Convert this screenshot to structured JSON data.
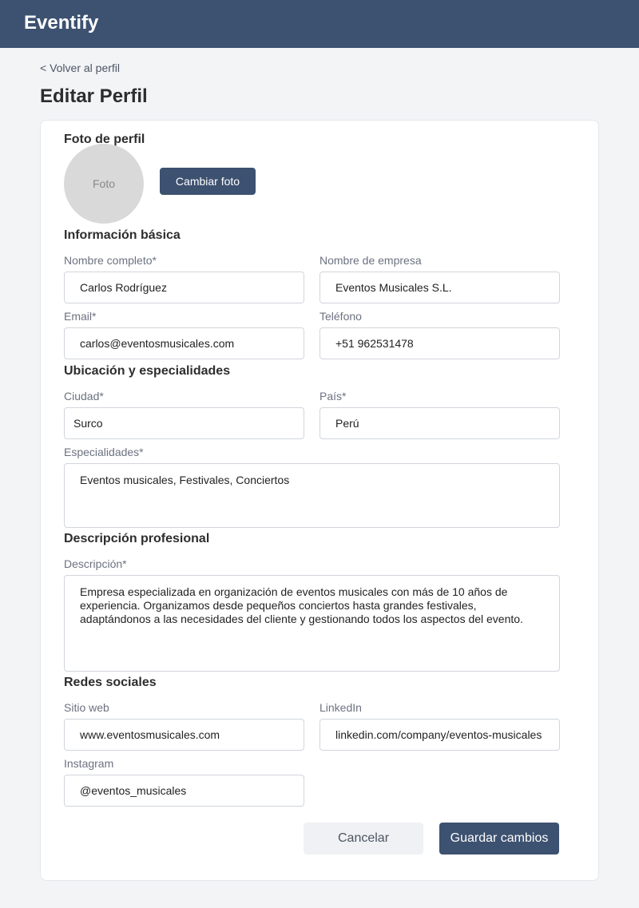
{
  "app": {
    "brand": "Eventify"
  },
  "nav": {
    "back_label": "< Volver al perfil"
  },
  "page": {
    "title": "Editar Perfil"
  },
  "photo": {
    "section_title": "Foto de perfil",
    "placeholder": "Foto",
    "change_label": "Cambiar foto"
  },
  "basic": {
    "section_title": "Información básica",
    "full_name": {
      "label": "Nombre completo*",
      "value": "Carlos Rodríguez"
    },
    "company": {
      "label": "Nombre de empresa",
      "value": "Eventos Musicales S.L."
    },
    "email": {
      "label": "Email*",
      "value": "carlos@eventosmusicales.com"
    },
    "phone": {
      "label": "Teléfono",
      "value": "+51 962531478"
    }
  },
  "location": {
    "section_title": "Ubicación y especialidades",
    "city": {
      "label": "Ciudad*",
      "value": "Surco"
    },
    "country": {
      "label": "País*",
      "value": "Perú"
    },
    "specialties": {
      "label": "Especialidades*",
      "value": "Eventos musicales, Festivales, Conciertos"
    }
  },
  "description": {
    "section_title": "Descripción profesional",
    "label": "Descripción*",
    "value": "Empresa especializada en organización de eventos musicales con más de 10 años de experiencia. Organizamos desde pequeños conciertos hasta grandes festivales, adaptándonos a las necesidades del cliente y gestionando todos los aspectos del evento."
  },
  "social": {
    "section_title": "Redes sociales",
    "website": {
      "label": "Sitio web",
      "value": "www.eventosmusicales.com"
    },
    "linkedin": {
      "label": "LinkedIn",
      "value": "linkedin.com/company/eventos-musicales"
    },
    "instagram": {
      "label": "Instagram",
      "value": "@eventos_musicales"
    }
  },
  "actions": {
    "cancel_label": "Cancelar",
    "save_label": "Guardar cambios"
  },
  "colors": {
    "header": "#3d5170",
    "primary_button": "#3d5170",
    "secondary_button": "#f0f1f4"
  }
}
